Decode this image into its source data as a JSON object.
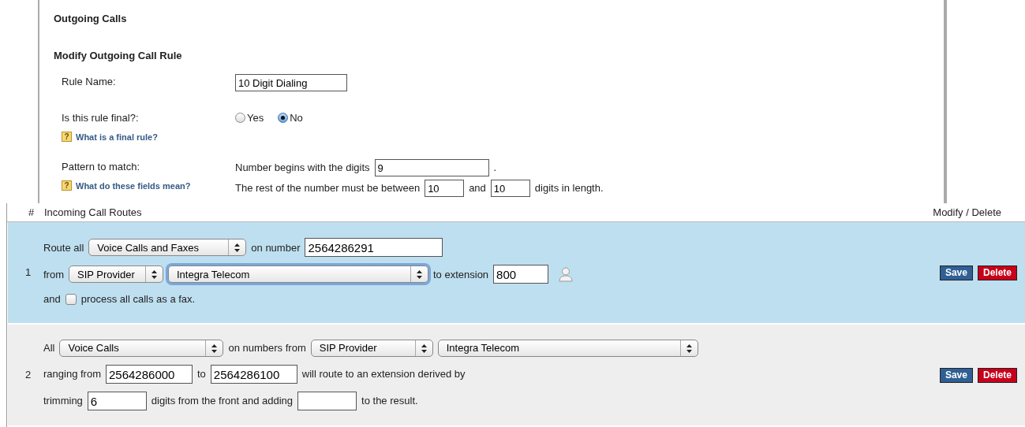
{
  "outgoing": {
    "title": "Outgoing Calls",
    "subtitle": "Modify Outgoing Call Rule",
    "rows": [
      {
        "label": "Rule Name:",
        "lines": [
          [
            {
              "kind": "input",
              "value": "10 Digit Dialing"
            }
          ]
        ]
      },
      {
        "label": "Is this rule final?:",
        "help": {
          "icon": "?",
          "text": "What is a final rule?"
        },
        "lines": [
          [
            {
              "kind": "radio",
              "text": "Yes",
              "selected": false
            },
            {
              "kind": "radio",
              "text": "No",
              "selected": true
            }
          ]
        ]
      },
      {
        "label": "Pattern to match:",
        "help": {
          "icon": "?",
          "text": "What do these fields mean?"
        },
        "lines": [
          [
            {
              "kind": "text",
              "text": "Number begins with the digits"
            },
            {
              "kind": "input",
              "value": "9"
            },
            {
              "kind": "text",
              "text": "."
            }
          ],
          [
            {
              "kind": "text",
              "text": "The rest of the number must be between"
            },
            {
              "kind": "input",
              "value": "10"
            },
            {
              "kind": "text",
              "text": "and"
            },
            {
              "kind": "input",
              "value": "10"
            },
            {
              "kind": "text",
              "text": "digits in length."
            }
          ]
        ]
      }
    ]
  },
  "incoming": {
    "columns": [
      "#",
      "Incoming Call Routes",
      "Modify / Delete"
    ],
    "routes": [
      {
        "number": "1",
        "selected": true,
        "lines": [
          [
            {
              "kind": "text",
              "text": "Route all"
            },
            {
              "kind": "select",
              "value": "Voice Calls and Faxes"
            },
            {
              "kind": "text",
              "text": "on number"
            },
            {
              "kind": "input",
              "value": "2564286291"
            }
          ],
          [
            {
              "kind": "text",
              "text": "from"
            },
            {
              "kind": "select",
              "value": "SIP Provider"
            },
            {
              "kind": "select",
              "value": "Integra Telecom",
              "focused": true
            },
            {
              "kind": "text",
              "text": "to extension"
            },
            {
              "kind": "input",
              "value": "800"
            },
            {
              "kind": "contact"
            }
          ],
          [
            {
              "kind": "text",
              "text": "and"
            },
            {
              "kind": "checkbox",
              "checked": false
            },
            {
              "kind": "text",
              "text": "process all calls as a fax."
            }
          ]
        ],
        "buttons": [
          {
            "kind": "save",
            "label": "Save"
          },
          {
            "kind": "delete",
            "label": "Delete"
          }
        ]
      },
      {
        "number": "2",
        "selected": false,
        "lines": [
          [
            {
              "kind": "text",
              "text": "All"
            },
            {
              "kind": "select",
              "value": "Voice Calls"
            },
            {
              "kind": "text",
              "text": "on numbers from"
            },
            {
              "kind": "select",
              "value": "SIP Provider"
            },
            {
              "kind": "select",
              "value": "Integra Telecom",
              "focused": false
            }
          ],
          [
            {
              "kind": "text",
              "text": "ranging from"
            },
            {
              "kind": "input",
              "value": "2564286000"
            },
            {
              "kind": "text",
              "text": "to"
            },
            {
              "kind": "input",
              "value": "2564286100"
            },
            {
              "kind": "text",
              "text": "will route to an extension derived by"
            }
          ],
          [
            {
              "kind": "text",
              "text": "trimming"
            },
            {
              "kind": "input",
              "value": "6"
            },
            {
              "kind": "text",
              "text": "digits from the front and adding"
            },
            {
              "kind": "input"
            },
            {
              "kind": "text",
              "text": "to the result."
            }
          ]
        ],
        "buttons": [
          {
            "kind": "save",
            "label": "Save"
          },
          {
            "kind": "delete",
            "label": "Delete"
          }
        ]
      }
    ]
  }
}
